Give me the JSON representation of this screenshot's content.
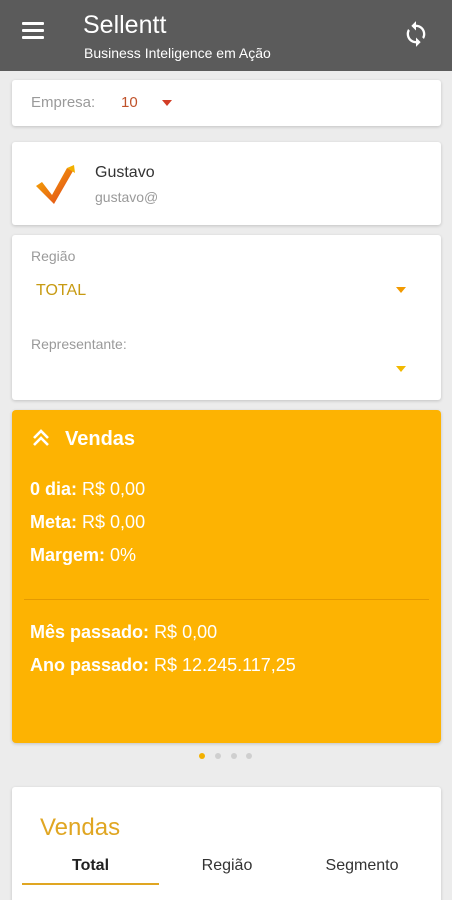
{
  "appbar": {
    "title": "Sellentt",
    "subtitle": "Business Inteligence em Ação",
    "menu_icon": "hamburger-menu-icon",
    "refresh_icon": "refresh-icon"
  },
  "empresa": {
    "label": "Empresa:",
    "value": "10"
  },
  "user": {
    "name": "Gustavo",
    "email": "gustavo@",
    "logo_icon": "sellentt-logo-icon"
  },
  "filters": {
    "regiao_label": "Região",
    "regiao_value": "TOTAL",
    "representante_label": "Representante:",
    "representante_value": ""
  },
  "vendas_card": {
    "title": "Vendas",
    "icon": "double-chevron-up-icon",
    "items": [
      {
        "label": "0 dia:",
        "value": "R$ 0,00"
      },
      {
        "label": "Meta:",
        "value": "R$ 0,00"
      },
      {
        "label": "Margem:",
        "value": "0%"
      },
      {
        "label": "Mês passado:",
        "value": "R$ 0,00"
      },
      {
        "label": "Ano passado:",
        "value": "R$ 12.245.117,25"
      }
    ]
  },
  "pager": {
    "count": 4,
    "active": 0
  },
  "chart_card": {
    "title": "Vendas",
    "tabs": [
      "Total",
      "Região",
      "Segmento"
    ],
    "active_tab": "Total"
  },
  "colors": {
    "appbar": "#5b5b5b",
    "accent": "#fdb302",
    "empresa_value": "#c0522a",
    "regiao_value": "#c79a12",
    "chart_title": "#e0a622"
  }
}
